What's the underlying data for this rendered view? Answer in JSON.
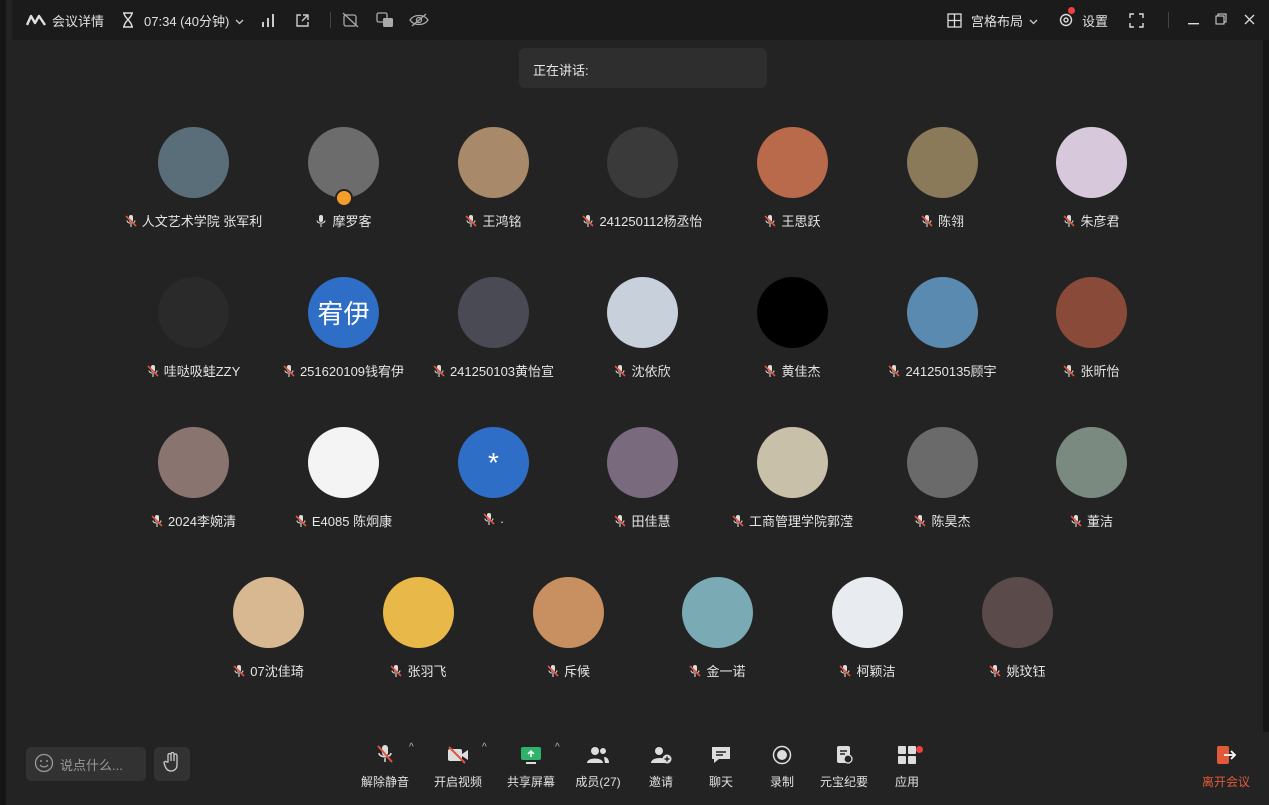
{
  "titlebar": {
    "meeting_details": "会议详情",
    "duration": "07:34 (40分钟)",
    "layout": "宫格布局",
    "settings": "设置"
  },
  "speaking_label": "正在讲话:",
  "participants": [
    {
      "name": "人文艺术学院 张军利",
      "avatar_color": "#5a6e7a",
      "mic": "muted"
    },
    {
      "name": "摩罗客",
      "avatar_color": "#6c6c6c",
      "mic": "on"
    },
    {
      "name": "王鸿铭",
      "avatar_color": "#a88a6a",
      "mic": "muted"
    },
    {
      "name": "241250112杨丞怡",
      "avatar_color": "#3a3a3a",
      "mic": "muted"
    },
    {
      "name": "王思跃",
      "avatar_color": "#b86a4a",
      "mic": "muted"
    },
    {
      "name": "陈翎",
      "avatar_color": "#8a7a5a",
      "mic": "muted"
    },
    {
      "name": "朱彦君",
      "avatar_color": "#d8c8dc",
      "mic": "muted"
    },
    {
      "name": "哇哒吸蛙ZZY",
      "avatar_color": "#2a2a2a",
      "mic": "muted"
    },
    {
      "name": "251620109钱宥伊",
      "avatar_color": "#2f6ec6",
      "avatar_text": "宥伊",
      "mic": "muted"
    },
    {
      "name": "241250103黄怡宣",
      "avatar_color": "#4a4a55",
      "mic": "muted"
    },
    {
      "name": "沈依欣",
      "avatar_color": "#c8d0dc",
      "mic": "muted"
    },
    {
      "name": "黄佳杰",
      "avatar_color": "#000000",
      "mic": "muted"
    },
    {
      "name": "241250135顾宇",
      "avatar_color": "#5a8ab0",
      "mic": "muted"
    },
    {
      "name": "张昕怡",
      "avatar_color": "#8a4a3a",
      "mic": "muted"
    },
    {
      "name": "2024李婉清",
      "avatar_color": "#8a7470",
      "mic": "muted"
    },
    {
      "name": "E4085 陈炯康",
      "avatar_color": "#f4f4f4",
      "mic": "muted"
    },
    {
      "name": ".",
      "avatar_color": "#2f6ec6",
      "avatar_text": "*",
      "mic": "muted"
    },
    {
      "name": "田佳慧",
      "avatar_color": "#7a6a7e",
      "mic": "muted"
    },
    {
      "name": "工商管理学院郭滢",
      "avatar_color": "#c8c0a8",
      "mic": "muted"
    },
    {
      "name": "陈昊杰",
      "avatar_color": "#6a6a6a",
      "mic": "muted"
    },
    {
      "name": "董洁",
      "avatar_color": "#7a8a80",
      "mic": "muted"
    },
    {
      "name": "07沈佳琦",
      "avatar_color": "#d8b890",
      "mic": "muted"
    },
    {
      "name": "张羽飞",
      "avatar_color": "#e8b848",
      "mic": "muted"
    },
    {
      "name": "斥候",
      "avatar_color": "#c89060",
      "mic": "muted"
    },
    {
      "name": "金一诺",
      "avatar_color": "#7aaab4",
      "mic": "muted"
    },
    {
      "name": "柯颖洁",
      "avatar_color": "#e8ecf0",
      "mic": "muted"
    },
    {
      "name": "姚玟钰",
      "avatar_color": "#5a4a4a",
      "mic": "muted"
    }
  ],
  "toolbar": {
    "chat_placeholder": "说点什么...",
    "unmute": "解除静音",
    "video": "开启视频",
    "share": "共享屏幕",
    "members": "成员(27)",
    "invite": "邀请",
    "chat": "聊天",
    "record": "录制",
    "minutes": "元宝纪要",
    "apps": "应用",
    "leave": "离开会议"
  },
  "colors": {
    "leave": "#e05a3a",
    "muted_mic": "#e0533f",
    "share_green": "#2fb36a"
  }
}
